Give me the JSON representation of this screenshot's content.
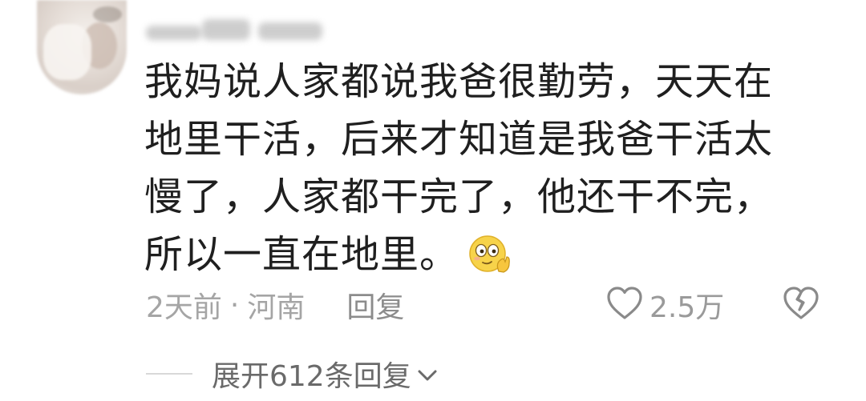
{
  "comment": {
    "text": "我妈说人家都说我爸很勤劳，天天在地里干活，后来才知道是我爸干活太慢了，人家都干完了，他还干不完，所以一直在地里。",
    "emoji_icon": "thinking-emoji-icon"
  },
  "meta": {
    "time": "2天前",
    "separator": "·",
    "location": "河南",
    "reply_label": "回复"
  },
  "actions": {
    "like_icon": "heart-outline-icon",
    "like_count": "2.5万",
    "dislike_icon": "broken-heart-icon"
  },
  "replies": {
    "expand_label": "展开612条回复",
    "expand_icon": "chevron-down-icon"
  },
  "colors": {
    "text": "#1f1f1f",
    "meta": "#9a9a9a",
    "icon": "#8a8a8a",
    "emoji_face": "#f7d34a"
  }
}
